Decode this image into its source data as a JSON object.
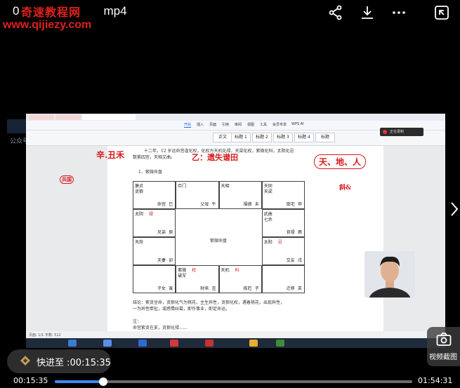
{
  "video": {
    "title": "0",
    "title_tail": "mp4",
    "current_time": "00:15:35",
    "total_time": "01:54:31",
    "progress": 0.136
  },
  "watermark": {
    "site_name": "奇速教程网",
    "url": "www.qijiezy.com"
  },
  "top_icons": [
    "share-icon",
    "download-icon",
    "more-icon",
    "exit-window-icon"
  ],
  "seek_toast": {
    "label": "快进至 :00:15:35"
  },
  "capture_button": {
    "label": "视频截图"
  },
  "side": {
    "text": "公众号 天玑"
  },
  "recording_indicator": {
    "label": "正在录制"
  },
  "wps": {
    "menus": [
      "开始",
      "插入",
      "页面",
      "引用",
      "审阅",
      "视图",
      "工具",
      "会员专享",
      "WPS AI"
    ],
    "styles": [
      "正文",
      "标题 1",
      "标题 2",
      "标题 3",
      "标题 4",
      "标题"
    ],
    "status_text": "页面: 1/1  字数: 512"
  },
  "document": {
    "intro_line1": "十二年，12 岁运命宫逢化权，化权为天机化禄，天梁化权，紫微化科，太阴化忌",
    "intro_line2": "数紫四宫，天相文曲。",
    "heading": "1、紫微命盘",
    "footer_line1": "结论：紫贪坐命，贪狼化气为桃花，主生异性，贪狼化权，遇着桃花，出现异性，",
    "footer_line2": "一为异性牵扯，或感情纠葛，即作事业，即定命运。",
    "footer_line3": "注：",
    "footer_line4": "命宫紫贪在亥，贪狼化禄……"
  },
  "chart": {
    "center_label": "紫微命盘",
    "cells": [
      {
        "star": "廉贞",
        "star2": "贪狼",
        "palace": "命宫",
        "branch": "巳"
      },
      {
        "star": "巨门",
        "star2": "",
        "palace": "父母",
        "branch": "午"
      },
      {
        "star": "天相",
        "star2": "",
        "palace": "福德",
        "branch": "未"
      },
      {
        "star": "天同",
        "star2": "天梁",
        "palace": "田宅",
        "branch": "申"
      },
      {
        "star": "太阴",
        "star2": "",
        "palace": "兄弟",
        "branch": "辰"
      },
      {
        "star": "武曲",
        "star2": "七杀",
        "palace": "官禄",
        "branch": "酉"
      },
      {
        "star": "天府",
        "star2": "",
        "palace": "夫妻",
        "branch": "卯"
      },
      {
        "star": "太阳",
        "star2": "",
        "palace": "交友",
        "branch": "戌"
      },
      {
        "star": "",
        "star2": "",
        "palace": "子女",
        "branch": "寅"
      },
      {
        "star": "紫微",
        "star2": "破军",
        "palace": "财帛",
        "branch": "丑"
      },
      {
        "star": "天机",
        "star2": "",
        "palace": "疾厄",
        "branch": "子"
      },
      {
        "star": "",
        "star2": "",
        "palace": "迁移",
        "branch": "亥"
      }
    ],
    "hua_marks": [
      "禄",
      "权",
      "科",
      "忌"
    ]
  },
  "annotations": {
    "left_top": "辛.丑禾",
    "middle": "乙：遗失谱田",
    "right_top": "天、地、人",
    "right_small": "斜&",
    "left_circle": "兵国"
  },
  "colors": {
    "accent": "#3e89f5",
    "annotation": "#d7191c",
    "watermark": "#e0201c"
  }
}
